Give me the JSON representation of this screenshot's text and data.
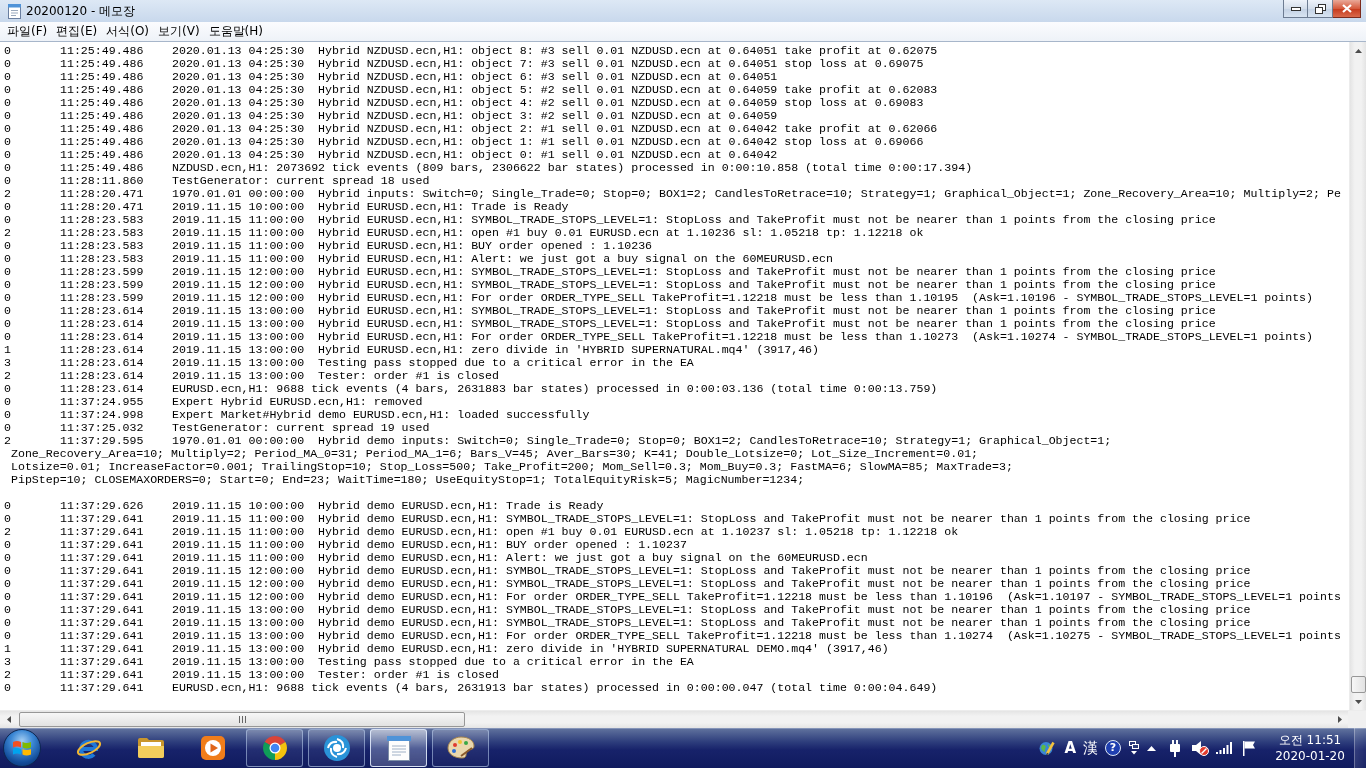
{
  "window": {
    "title": "20200120 - 메모장"
  },
  "menu": [
    "파일(F)",
    "편집(E)",
    "서식(O)",
    "보기(V)",
    "도움말(H)"
  ],
  "document": {
    "lines": [
      {
        "kind": "entry",
        "code": "0",
        "time": "11:25:49.486",
        "message": "2020.01.13 04:25:30  Hybrid NZDUSD.ecn,H1: object 8: #3 sell 0.01 NZDUSD.ecn at 0.64051 take profit at 0.62075"
      },
      {
        "kind": "entry",
        "code": "0",
        "time": "11:25:49.486",
        "message": "2020.01.13 04:25:30  Hybrid NZDUSD.ecn,H1: object 7: #3 sell 0.01 NZDUSD.ecn at 0.64051 stop loss at 0.69075"
      },
      {
        "kind": "entry",
        "code": "0",
        "time": "11:25:49.486",
        "message": "2020.01.13 04:25:30  Hybrid NZDUSD.ecn,H1: object 6: #3 sell 0.01 NZDUSD.ecn at 0.64051"
      },
      {
        "kind": "entry",
        "code": "0",
        "time": "11:25:49.486",
        "message": "2020.01.13 04:25:30  Hybrid NZDUSD.ecn,H1: object 5: #2 sell 0.01 NZDUSD.ecn at 0.64059 take profit at 0.62083"
      },
      {
        "kind": "entry",
        "code": "0",
        "time": "11:25:49.486",
        "message": "2020.01.13 04:25:30  Hybrid NZDUSD.ecn,H1: object 4: #2 sell 0.01 NZDUSD.ecn at 0.64059 stop loss at 0.69083"
      },
      {
        "kind": "entry",
        "code": "0",
        "time": "11:25:49.486",
        "message": "2020.01.13 04:25:30  Hybrid NZDUSD.ecn,H1: object 3: #2 sell 0.01 NZDUSD.ecn at 0.64059"
      },
      {
        "kind": "entry",
        "code": "0",
        "time": "11:25:49.486",
        "message": "2020.01.13 04:25:30  Hybrid NZDUSD.ecn,H1: object 2: #1 sell 0.01 NZDUSD.ecn at 0.64042 take profit at 0.62066"
      },
      {
        "kind": "entry",
        "code": "0",
        "time": "11:25:49.486",
        "message": "2020.01.13 04:25:30  Hybrid NZDUSD.ecn,H1: object 1: #1 sell 0.01 NZDUSD.ecn at 0.64042 stop loss at 0.69066"
      },
      {
        "kind": "entry",
        "code": "0",
        "time": "11:25:49.486",
        "message": "2020.01.13 04:25:30  Hybrid NZDUSD.ecn,H1: object 0: #1 sell 0.01 NZDUSD.ecn at 0.64042"
      },
      {
        "kind": "entry",
        "code": "0",
        "time": "11:25:49.486",
        "message": "NZDUSD.ecn,H1: 2073692 tick events (809 bars, 2306622 bar states) processed in 0:00:10.858 (total time 0:00:17.394)"
      },
      {
        "kind": "entry",
        "code": "0",
        "time": "11:28:11.860",
        "message": "TestGenerator: current spread 18 used"
      },
      {
        "kind": "entry",
        "code": "2",
        "time": "11:28:20.471",
        "message": "1970.01.01 00:00:00  Hybrid inputs: Switch=0; Single_Trade=0; Stop=0; BOX1=2; CandlesToRetrace=10; Strategy=1; Graphical_Object=1; Zone_Recovery_Area=10; Multiply=2; Pe"
      },
      {
        "kind": "entry",
        "code": "0",
        "time": "11:28:20.471",
        "message": "2019.11.15 10:00:00  Hybrid EURUSD.ecn,H1: Trade is Ready"
      },
      {
        "kind": "entry",
        "code": "0",
        "time": "11:28:23.583",
        "message": "2019.11.15 11:00:00  Hybrid EURUSD.ecn,H1: SYMBOL_TRADE_STOPS_LEVEL=1: StopLoss and TakeProfit must not be nearer than 1 points from the closing price"
      },
      {
        "kind": "entry",
        "code": "2",
        "time": "11:28:23.583",
        "message": "2019.11.15 11:00:00  Hybrid EURUSD.ecn,H1: open #1 buy 0.01 EURUSD.ecn at 1.10236 sl: 1.05218 tp: 1.12218 ok"
      },
      {
        "kind": "entry",
        "code": "0",
        "time": "11:28:23.583",
        "message": "2019.11.15 11:00:00  Hybrid EURUSD.ecn,H1: BUY order opened : 1.10236"
      },
      {
        "kind": "entry",
        "code": "0",
        "time": "11:28:23.583",
        "message": "2019.11.15 11:00:00  Hybrid EURUSD.ecn,H1: Alert: we just got a buy signal on the 60MEURUSD.ecn"
      },
      {
        "kind": "entry",
        "code": "0",
        "time": "11:28:23.599",
        "message": "2019.11.15 12:00:00  Hybrid EURUSD.ecn,H1: SYMBOL_TRADE_STOPS_LEVEL=1: StopLoss and TakeProfit must not be nearer than 1 points from the closing price"
      },
      {
        "kind": "entry",
        "code": "0",
        "time": "11:28:23.599",
        "message": "2019.11.15 12:00:00  Hybrid EURUSD.ecn,H1: SYMBOL_TRADE_STOPS_LEVEL=1: StopLoss and TakeProfit must not be nearer than 1 points from the closing price"
      },
      {
        "kind": "entry",
        "code": "0",
        "time": "11:28:23.599",
        "message": "2019.11.15 12:00:00  Hybrid EURUSD.ecn,H1: For order ORDER_TYPE_SELL TakeProfit=1.12218 must be less than 1.10195  (Ask=1.10196 - SYMBOL_TRADE_STOPS_LEVEL=1 points)"
      },
      {
        "kind": "entry",
        "code": "0",
        "time": "11:28:23.614",
        "message": "2019.11.15 13:00:00  Hybrid EURUSD.ecn,H1: SYMBOL_TRADE_STOPS_LEVEL=1: StopLoss and TakeProfit must not be nearer than 1 points from the closing price"
      },
      {
        "kind": "entry",
        "code": "0",
        "time": "11:28:23.614",
        "message": "2019.11.15 13:00:00  Hybrid EURUSD.ecn,H1: SYMBOL_TRADE_STOPS_LEVEL=1: StopLoss and TakeProfit must not be nearer than 1 points from the closing price"
      },
      {
        "kind": "entry",
        "code": "0",
        "time": "11:28:23.614",
        "message": "2019.11.15 13:00:00  Hybrid EURUSD.ecn,H1: For order ORDER_TYPE_SELL TakeProfit=1.12218 must be less than 1.10273  (Ask=1.10274 - SYMBOL_TRADE_STOPS_LEVEL=1 points)"
      },
      {
        "kind": "entry",
        "code": "1",
        "time": "11:28:23.614",
        "message": "2019.11.15 13:00:00  Hybrid EURUSD.ecn,H1: zero divide in 'HYBRID SUPERNATURAL.mq4' (3917,46)"
      },
      {
        "kind": "entry",
        "code": "3",
        "time": "11:28:23.614",
        "message": "2019.11.15 13:00:00  Testing pass stopped due to a critical error in the EA"
      },
      {
        "kind": "entry",
        "code": "2",
        "time": "11:28:23.614",
        "message": "2019.11.15 13:00:00  Tester: order #1 is closed"
      },
      {
        "kind": "entry",
        "code": "0",
        "time": "11:28:23.614",
        "message": "EURUSD.ecn,H1: 9688 tick events (4 bars, 2631883 bar states) processed in 0:00:03.136 (total time 0:00:13.759)"
      },
      {
        "kind": "entry",
        "code": "0",
        "time": "11:37:24.955",
        "message": "Expert Hybrid EURUSD.ecn,H1: removed"
      },
      {
        "kind": "entry",
        "code": "0",
        "time": "11:37:24.998",
        "message": "Expert Market#Hybrid demo EURUSD.ecn,H1: loaded successfully"
      },
      {
        "kind": "entry",
        "code": "0",
        "time": "11:37:25.032",
        "message": "TestGenerator: current spread 19 used"
      },
      {
        "kind": "entry",
        "code": "2",
        "time": "11:37:29.595",
        "message": "1970.01.01 00:00:00  Hybrid demo inputs: Switch=0; Single_Trade=0; Stop=0; BOX1=2; CandlesToRetrace=10; Strategy=1; Graphical_Object=1;"
      },
      {
        "kind": "continuation",
        "text": "Zone_Recovery_Area=10; Multiply=2; Period_MA_0=31; Period_MA_1=6; Bars_V=45; Aver_Bars=30; K=41; Double_Lotsize=0; Lot_Size_Increment=0.01;"
      },
      {
        "kind": "continuation",
        "text": "Lotsize=0.01; IncreaseFactor=0.001; TrailingStop=10; Stop_Loss=500; Take_Profit=200; Mom_Sell=0.3; Mom_Buy=0.3; FastMA=6; SlowMA=85; MaxTrade=3;"
      },
      {
        "kind": "continuation",
        "text": "PipStep=10; CLOSEMAXORDERS=0; Start=0; End=23; WaitTime=180; UseEquityStop=1; TotalEquityRisk=5; MagicNumber=1234;"
      },
      {
        "kind": "blank"
      },
      {
        "kind": "entry",
        "code": "0",
        "time": "11:37:29.626",
        "message": "2019.11.15 10:00:00  Hybrid demo EURUSD.ecn,H1: Trade is Ready"
      },
      {
        "kind": "entry",
        "code": "0",
        "time": "11:37:29.641",
        "message": "2019.11.15 11:00:00  Hybrid demo EURUSD.ecn,H1: SYMBOL_TRADE_STOPS_LEVEL=1: StopLoss and TakeProfit must not be nearer than 1 points from the closing price"
      },
      {
        "kind": "entry",
        "code": "2",
        "time": "11:37:29.641",
        "message": "2019.11.15 11:00:00  Hybrid demo EURUSD.ecn,H1: open #1 buy 0.01 EURUSD.ecn at 1.10237 sl: 1.05218 tp: 1.12218 ok"
      },
      {
        "kind": "entry",
        "code": "0",
        "time": "11:37:29.641",
        "message": "2019.11.15 11:00:00  Hybrid demo EURUSD.ecn,H1: BUY order opened : 1.10237"
      },
      {
        "kind": "entry",
        "code": "0",
        "time": "11:37:29.641",
        "message": "2019.11.15 11:00:00  Hybrid demo EURUSD.ecn,H1: Alert: we just got a buy signal on the 60MEURUSD.ecn"
      },
      {
        "kind": "entry",
        "code": "0",
        "time": "11:37:29.641",
        "message": "2019.11.15 12:00:00  Hybrid demo EURUSD.ecn,H1: SYMBOL_TRADE_STOPS_LEVEL=1: StopLoss and TakeProfit must not be nearer than 1 points from the closing price"
      },
      {
        "kind": "entry",
        "code": "0",
        "time": "11:37:29.641",
        "message": "2019.11.15 12:00:00  Hybrid demo EURUSD.ecn,H1: SYMBOL_TRADE_STOPS_LEVEL=1: StopLoss and TakeProfit must not be nearer than 1 points from the closing price"
      },
      {
        "kind": "entry",
        "code": "0",
        "time": "11:37:29.641",
        "message": "2019.11.15 12:00:00  Hybrid demo EURUSD.ecn,H1: For order ORDER_TYPE_SELL TakeProfit=1.12218 must be less than 1.10196  (Ask=1.10197 - SYMBOL_TRADE_STOPS_LEVEL=1 points"
      },
      {
        "kind": "entry",
        "code": "0",
        "time": "11:37:29.641",
        "message": "2019.11.15 13:00:00  Hybrid demo EURUSD.ecn,H1: SYMBOL_TRADE_STOPS_LEVEL=1: StopLoss and TakeProfit must not be nearer than 1 points from the closing price"
      },
      {
        "kind": "entry",
        "code": "0",
        "time": "11:37:29.641",
        "message": "2019.11.15 13:00:00  Hybrid demo EURUSD.ecn,H1: SYMBOL_TRADE_STOPS_LEVEL=1: StopLoss and TakeProfit must not be nearer than 1 points from the closing price"
      },
      {
        "kind": "entry",
        "code": "0",
        "time": "11:37:29.641",
        "message": "2019.11.15 13:00:00  Hybrid demo EURUSD.ecn,H1: For order ORDER_TYPE_SELL TakeProfit=1.12218 must be less than 1.10274  (Ask=1.10275 - SYMBOL_TRADE_STOPS_LEVEL=1 points"
      },
      {
        "kind": "entry",
        "code": "1",
        "time": "11:37:29.641",
        "message": "2019.11.15 13:00:00  Hybrid demo EURUSD.ecn,H1: zero divide in 'HYBRID SUPERNATURAL DEMO.mq4' (3917,46)"
      },
      {
        "kind": "entry",
        "code": "3",
        "time": "11:37:29.641",
        "message": "2019.11.15 13:00:00  Testing pass stopped due to a critical error in the EA"
      },
      {
        "kind": "entry",
        "code": "2",
        "time": "11:37:29.641",
        "message": "2019.11.15 13:00:00  Tester: order #1 is closed"
      },
      {
        "kind": "entry",
        "code": "0",
        "time": "11:37:29.641",
        "message": "EURUSD.ecn,H1: 9688 tick events (4 bars, 2631913 bar states) processed in 0:00:00.047 (total time 0:00:04.649)"
      }
    ]
  },
  "taskbar": {
    "apps": [
      {
        "kind": "elogo",
        "running": false,
        "selected": false
      },
      {
        "kind": "folder",
        "running": false,
        "selected": false
      },
      {
        "kind": "player",
        "running": false,
        "selected": false
      },
      {
        "kind": "ringlogo",
        "running": true,
        "selected": false
      },
      {
        "kind": "swirl",
        "running": true,
        "selected": false
      },
      {
        "kind": "notepad",
        "running": true,
        "selected": true
      },
      {
        "kind": "palette",
        "running": true,
        "selected": false
      }
    ],
    "language_bar": {
      "mode": "A",
      "hanja": "漢",
      "help": "?"
    },
    "clock": {
      "time": "오전 11:51",
      "date": "2020-01-20"
    }
  }
}
